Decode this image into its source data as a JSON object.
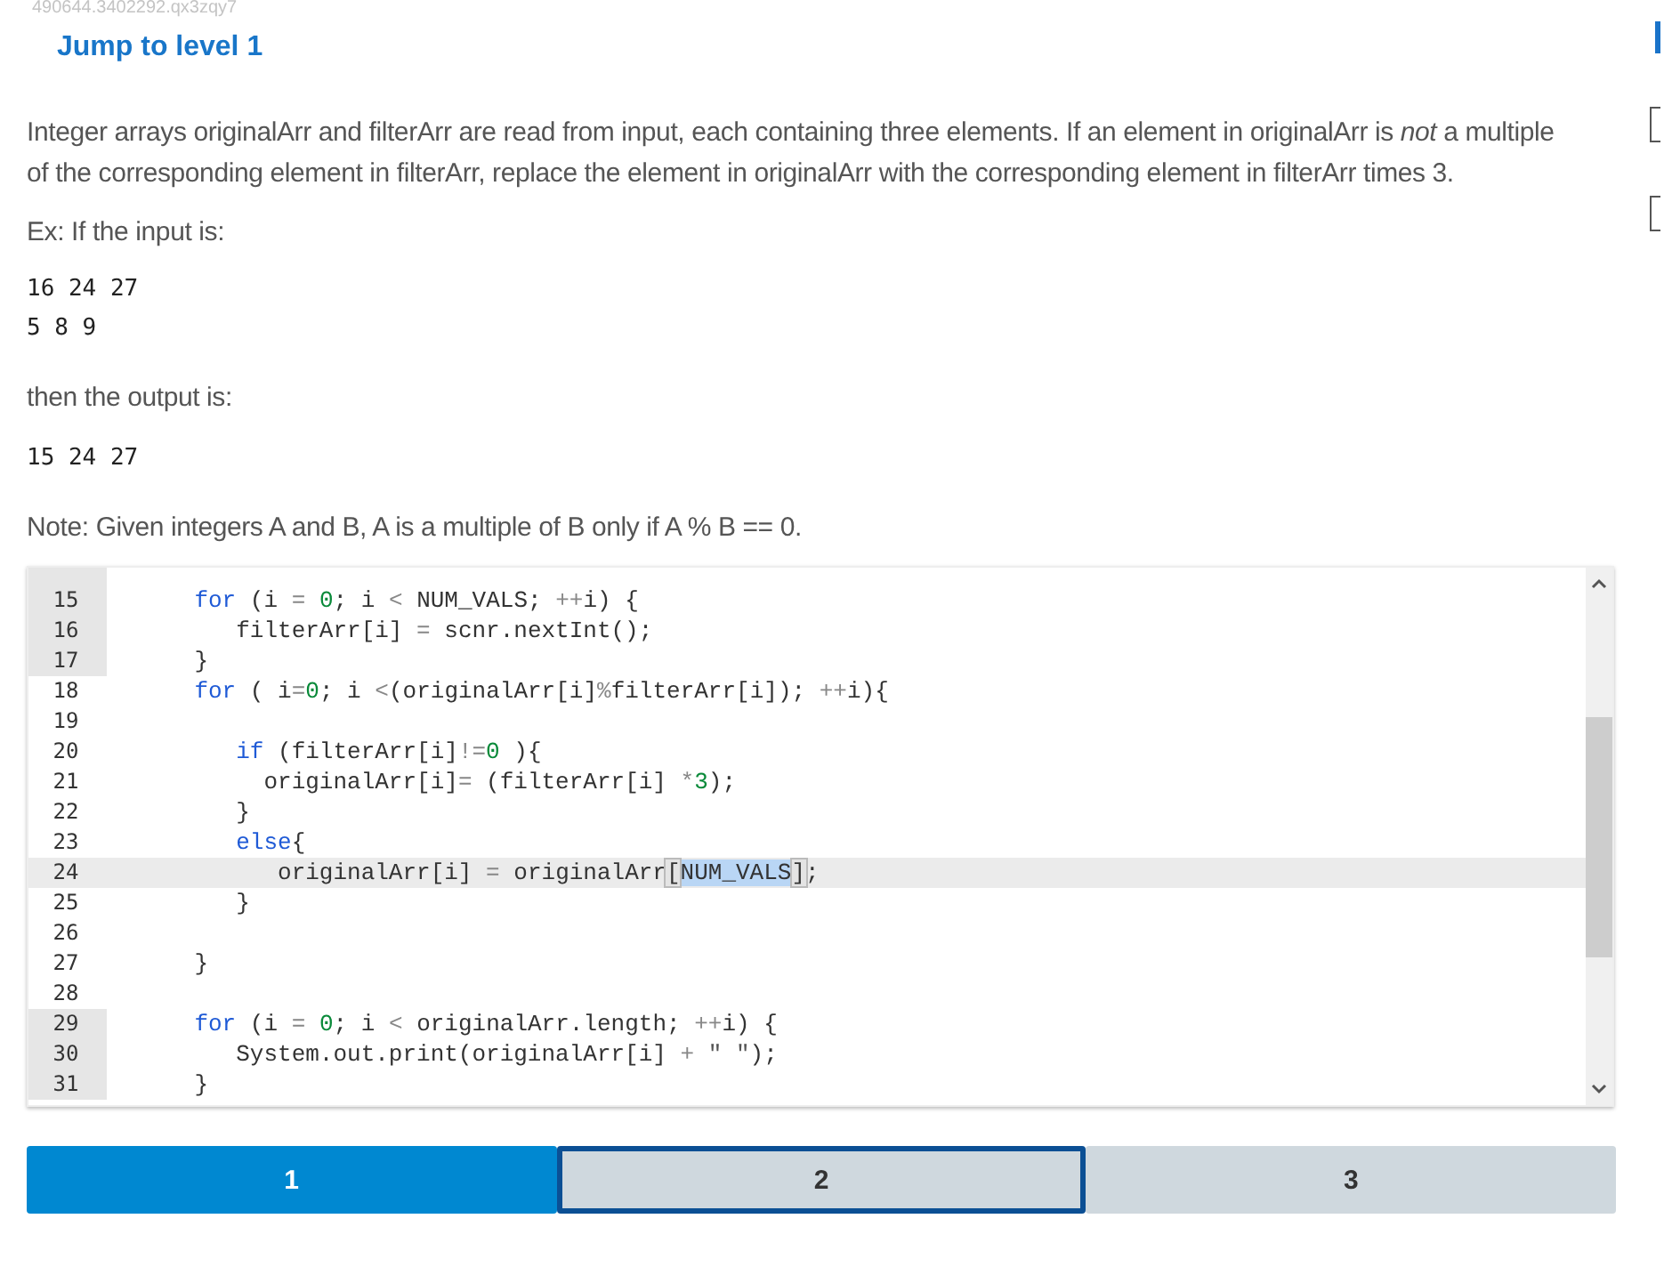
{
  "page_id": "490644.3402292.qx3zqy7",
  "jump_link": "Jump to level 1",
  "description": "Integer arrays originalArr and filterArr are read from input, each containing three elements. If an element in originalArr is *not* a multiple of the corresponding element in filterArr, replace the element in originalArr with the corresponding element in filterArr times 3.",
  "example_intro": "Ex: If the input is:",
  "example_input": [
    "16 24 27",
    "5 8 9"
  ],
  "output_intro": "then the output is:",
  "example_output": [
    "15 24 27"
  ],
  "note": "Note: Given integers A and B, A is a multiple of B only if A % B == 0.",
  "editor": {
    "lines": [
      {
        "number": "15",
        "locked": true,
        "active": false,
        "tokens": [
          {
            "kind": "k",
            "text": "    for"
          },
          {
            "kind": "p",
            "text": " (i "
          },
          {
            "kind": "o",
            "text": "= "
          },
          {
            "kind": "n",
            "text": "0"
          },
          {
            "kind": "p",
            "text": "; i "
          },
          {
            "kind": "o",
            "text": "<"
          },
          {
            "kind": "p",
            "text": " NUM_VALS; "
          },
          {
            "kind": "o",
            "text": "++"
          },
          {
            "kind": "p",
            "text": "i) {"
          }
        ]
      },
      {
        "number": "16",
        "locked": true,
        "active": false,
        "tokens": [
          {
            "kind": "p",
            "text": "       filterArr[i] "
          },
          {
            "kind": "o",
            "text": "="
          },
          {
            "kind": "p",
            "text": " scnr.nextInt();"
          }
        ]
      },
      {
        "number": "17",
        "locked": true,
        "active": false,
        "tokens": [
          {
            "kind": "p",
            "text": "    }"
          }
        ]
      },
      {
        "number": "18",
        "locked": false,
        "active": false,
        "tokens": [
          {
            "kind": "k",
            "text": "    for"
          },
          {
            "kind": "p",
            "text": " ( i"
          },
          {
            "kind": "o",
            "text": "="
          },
          {
            "kind": "n",
            "text": "0"
          },
          {
            "kind": "p",
            "text": "; i "
          },
          {
            "kind": "o",
            "text": "<"
          },
          {
            "kind": "p",
            "text": "(originalArr[i]"
          },
          {
            "kind": "o",
            "text": "%"
          },
          {
            "kind": "p",
            "text": "filterArr[i]); "
          },
          {
            "kind": "o",
            "text": "++"
          },
          {
            "kind": "p",
            "text": "i){"
          }
        ]
      },
      {
        "number": "19",
        "locked": false,
        "active": false
      },
      {
        "number": "20",
        "locked": false,
        "active": false,
        "tokens": [
          {
            "kind": "k",
            "text": "       if"
          },
          {
            "kind": "p",
            "text": " (filterArr[i]"
          },
          {
            "kind": "o",
            "text": "!="
          },
          {
            "kind": "n",
            "text": "0"
          },
          {
            "kind": "p",
            "text": " ){"
          }
        ]
      },
      {
        "number": "21",
        "locked": false,
        "active": false,
        "tokens": [
          {
            "kind": "p",
            "text": "         originalArr[i]"
          },
          {
            "kind": "o",
            "text": "="
          },
          {
            "kind": "p",
            "text": " (filterArr[i] "
          },
          {
            "kind": "o",
            "text": "*"
          },
          {
            "kind": "n",
            "text": "3"
          },
          {
            "kind": "p",
            "text": ");"
          }
        ]
      },
      {
        "number": "22",
        "locked": false,
        "active": false,
        "tokens": [
          {
            "kind": "p",
            "text": "       }"
          }
        ]
      },
      {
        "number": "23",
        "locked": false,
        "active": false,
        "tokens": [
          {
            "kind": "k",
            "text": "       else"
          },
          {
            "kind": "p",
            "text": "{"
          }
        ]
      },
      {
        "number": "24",
        "locked": false,
        "active": true,
        "tokens": [
          {
            "kind": "p",
            "text": "          originalArr[i] "
          },
          {
            "kind": "o",
            "text": "="
          },
          {
            "kind": "p",
            "text": " originalArr"
          },
          {
            "kind": "br",
            "text": "["
          },
          {
            "kind": "sel",
            "text": "NUM_VALS"
          },
          {
            "kind": "br",
            "text": "]"
          },
          {
            "kind": "p",
            "text": ";"
          }
        ]
      },
      {
        "number": "25",
        "locked": false,
        "active": false,
        "tokens": [
          {
            "kind": "p",
            "text": "       }"
          }
        ]
      },
      {
        "number": "26",
        "locked": false,
        "active": false
      },
      {
        "number": "27",
        "locked": false,
        "active": false,
        "tokens": [
          {
            "kind": "p",
            "text": "    }"
          }
        ]
      },
      {
        "number": "28",
        "locked": false,
        "active": false
      },
      {
        "number": "29",
        "locked": true,
        "active": false,
        "tokens": [
          {
            "kind": "k",
            "text": "    for"
          },
          {
            "kind": "p",
            "text": " (i "
          },
          {
            "kind": "o",
            "text": "= "
          },
          {
            "kind": "n",
            "text": "0"
          },
          {
            "kind": "p",
            "text": "; i "
          },
          {
            "kind": "o",
            "text": "<"
          },
          {
            "kind": "p",
            "text": " originalArr.length; "
          },
          {
            "kind": "o",
            "text": "++"
          },
          {
            "kind": "p",
            "text": "i) {"
          }
        ]
      },
      {
        "number": "30",
        "locked": true,
        "active": false,
        "tokens": [
          {
            "kind": "p",
            "text": "       System.out.print(originalArr[i] "
          },
          {
            "kind": "o",
            "text": "+"
          },
          {
            "kind": "s",
            "text": " \" \""
          },
          {
            "kind": "p",
            "text": ");"
          }
        ]
      },
      {
        "number": "31",
        "locked": true,
        "active": false,
        "tokens": [
          {
            "kind": "p",
            "text": "    }"
          }
        ]
      }
    ]
  },
  "levels": [
    {
      "label": "1",
      "completed": true,
      "selected": false
    },
    {
      "label": "2",
      "completed": false,
      "selected": true
    },
    {
      "label": "3",
      "completed": false,
      "selected": false
    }
  ]
}
